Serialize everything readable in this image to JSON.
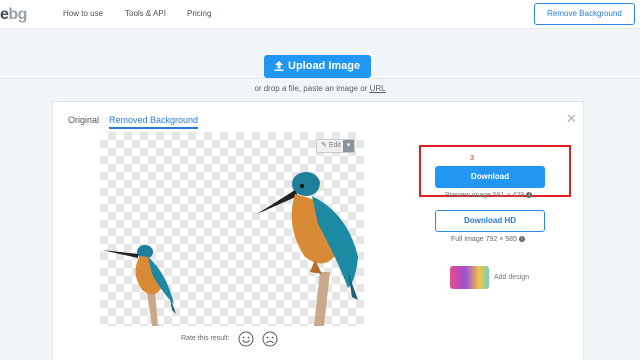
{
  "header": {
    "logo_e": "e",
    "logo_bg": "bg",
    "nav": [
      "How to use",
      "Tools & API",
      "Pricing"
    ],
    "remove_bg_button": "Remove Background"
  },
  "upload": {
    "button_label": "Upload Image",
    "drop_text_prefix": "or drop a file, paste an image or ",
    "drop_text_link": "URL"
  },
  "result": {
    "tabs": [
      "Original",
      "Removed Background"
    ],
    "active_tab": "Removed Background",
    "edit_label": "Edit",
    "step_annotation": "3",
    "download_label": "Download",
    "preview_info": "Preview image 581 × 429",
    "download_hd_label": "Download HD",
    "full_info": "Full Image 792 × 585",
    "add_design": "Add design",
    "rate_label": "Rate this result:"
  },
  "colors": {
    "accent": "#2196f3",
    "annotation": "#e02020"
  }
}
